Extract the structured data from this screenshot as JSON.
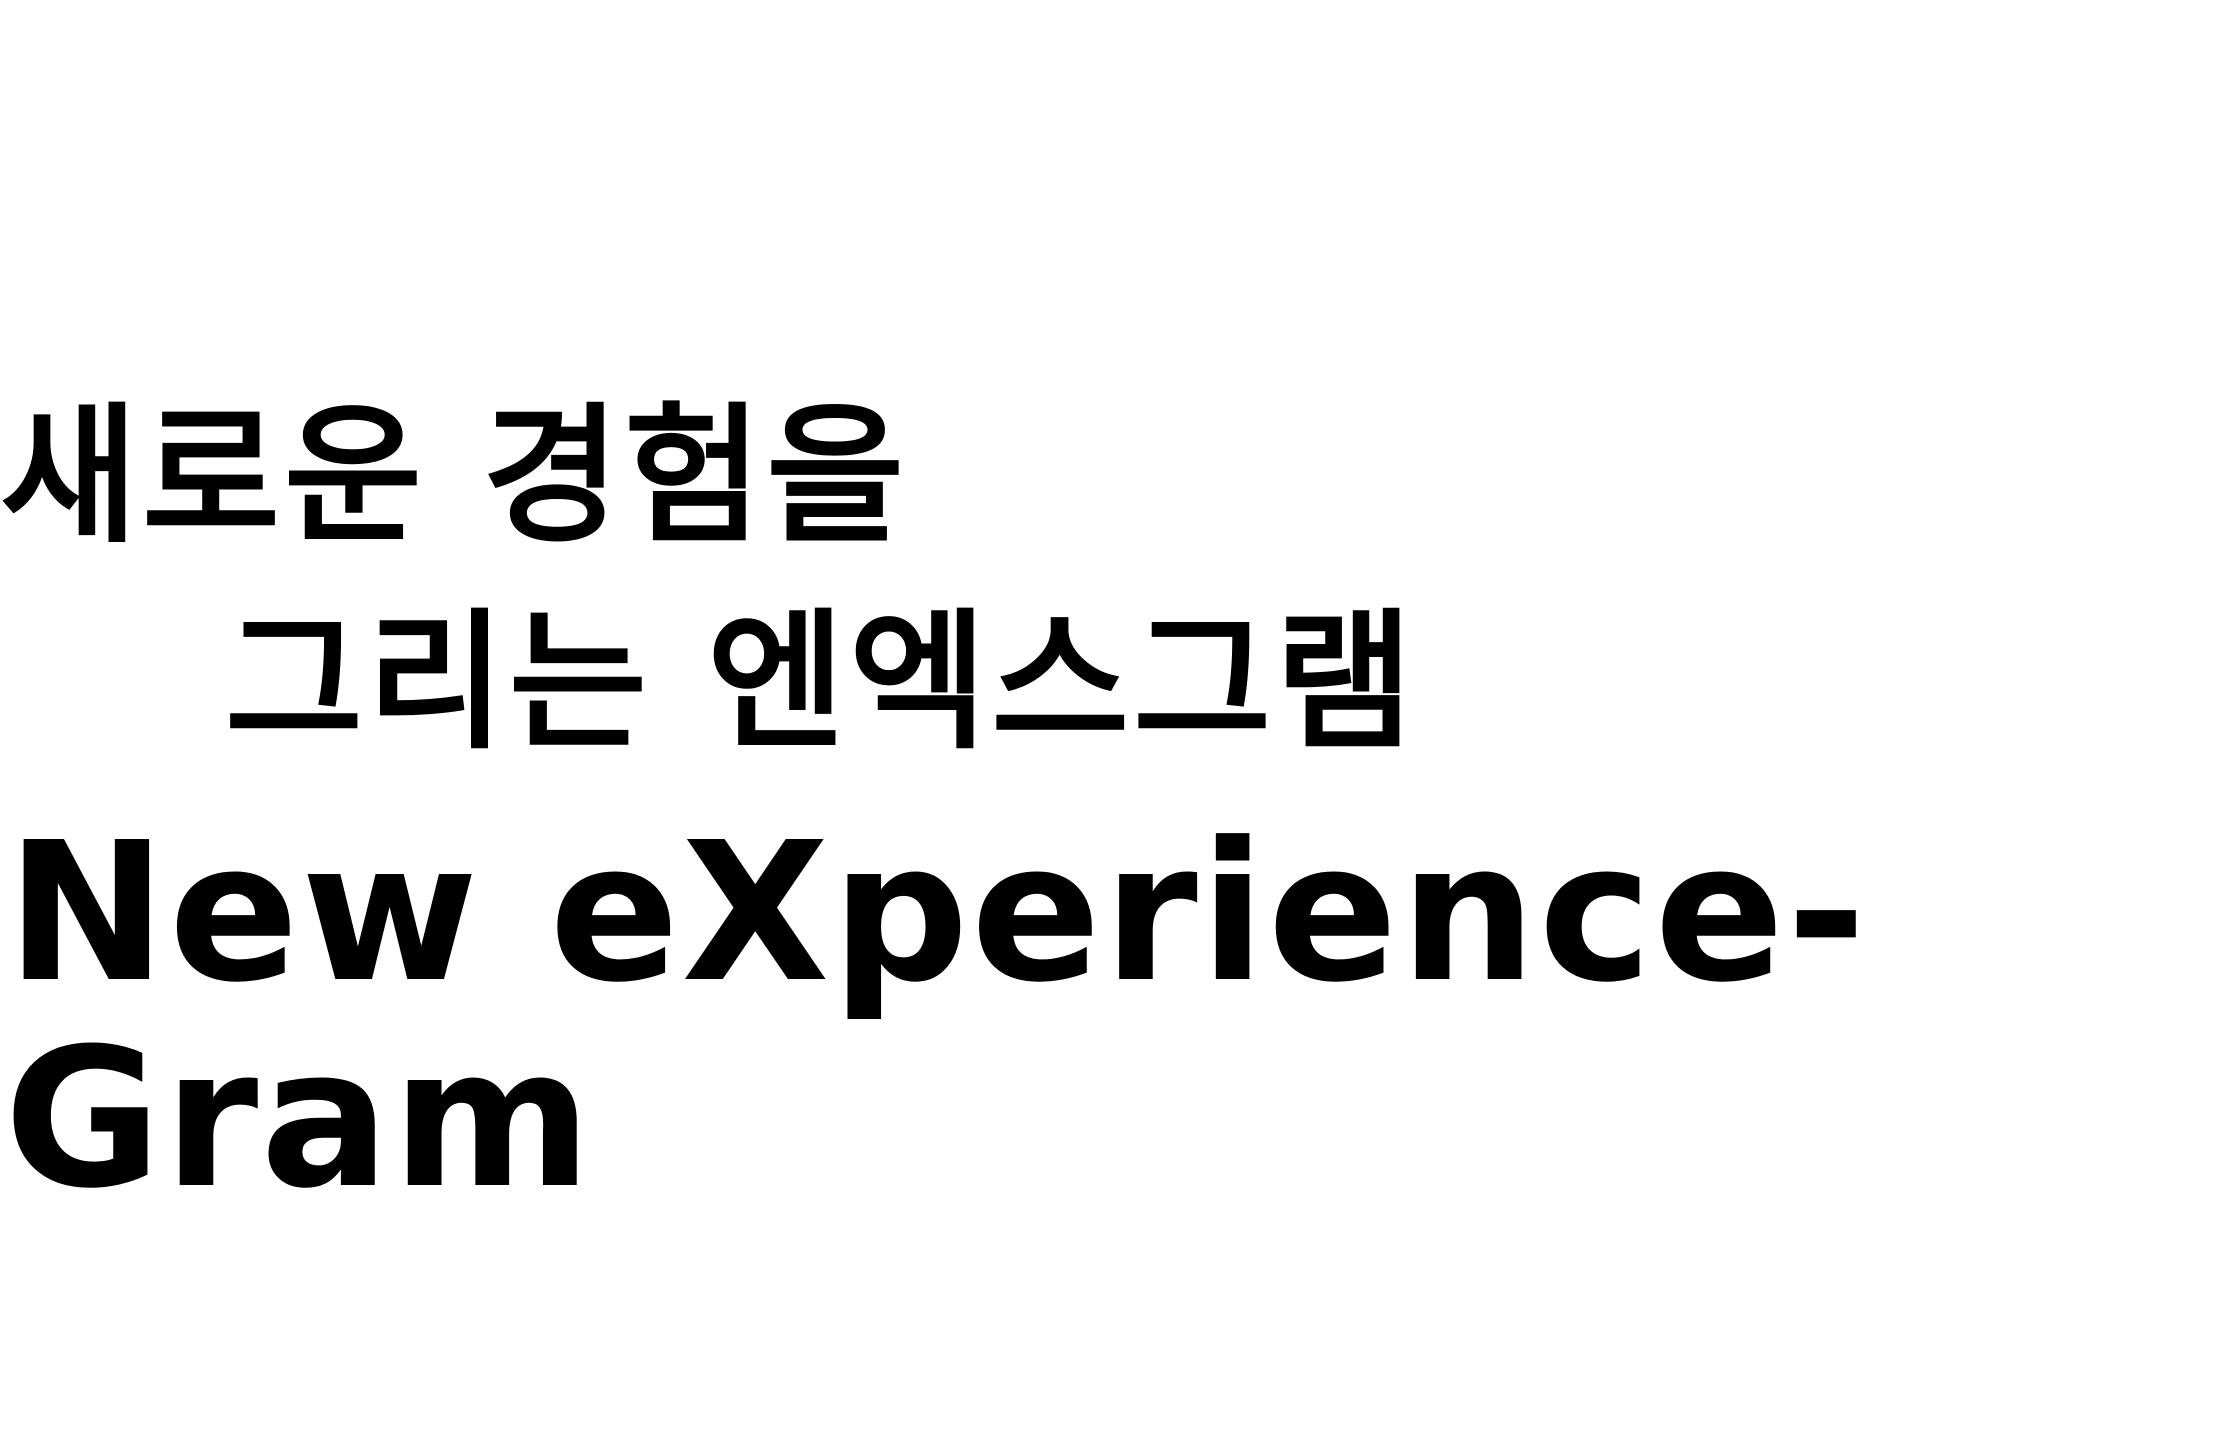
{
  "headline": {
    "korean_line_1": "새로운 경험을",
    "korean_line_2": "그리는 엔엑스그램",
    "english_line_1": "New eXperience-",
    "english_line_2": "Gram"
  }
}
